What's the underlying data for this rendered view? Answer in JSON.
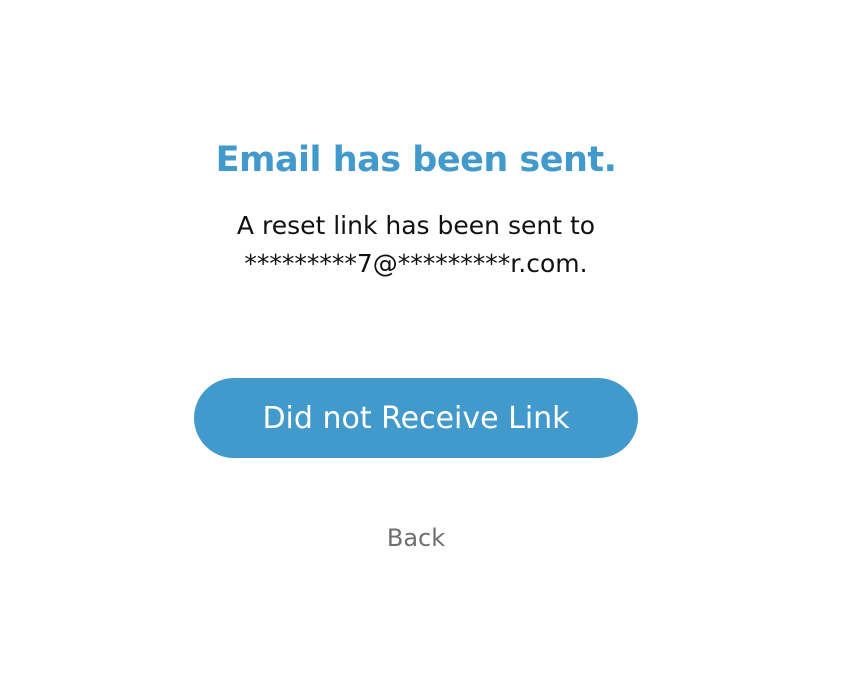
{
  "heading": "Email has been sent.",
  "message": {
    "line1": "A reset link has been sent to",
    "email": "*********7@*********r.com."
  },
  "actions": {
    "resend_label": "Did not Receive Link",
    "back_label": "Back"
  },
  "colors": {
    "accent": "#4299cc",
    "text": "#111111",
    "secondary_text": "#6f6f6f",
    "background": "#ffffff"
  }
}
